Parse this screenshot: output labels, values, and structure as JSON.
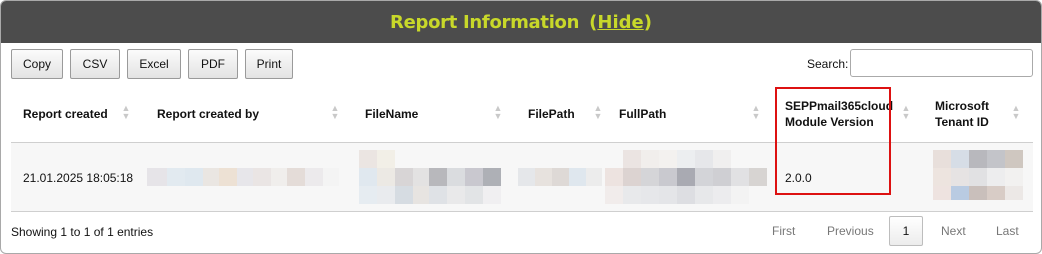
{
  "header": {
    "title": "Report Information",
    "hide_open": "(",
    "hide_link": "Hide",
    "hide_close": ")"
  },
  "toolbar": {
    "copy": "Copy",
    "csv": "CSV",
    "excel": "Excel",
    "pdf": "PDF",
    "print": "Print"
  },
  "search": {
    "label": "Search:",
    "value": ""
  },
  "table": {
    "columns": [
      "Report created",
      "Report created by",
      "FileName",
      "FilePath",
      "FullPath",
      "SEPPmail365cloud",
      "Module Version",
      "Microsoft",
      "Tenant ID"
    ],
    "row": {
      "report_created": "21.01.2025 18:05:18",
      "module_version": "2.0.0"
    }
  },
  "footer": {
    "info": "Showing 1 to 1 of 1 entries",
    "first": "First",
    "previous": "Previous",
    "current_page": "1",
    "next": "Next",
    "last": "Last"
  },
  "colors": {
    "header_bg": "#4c4c4c",
    "header_text": "#c8d82a",
    "highlight_border": "#dd1111"
  },
  "icons": {
    "sort": "sort-both-icon"
  }
}
